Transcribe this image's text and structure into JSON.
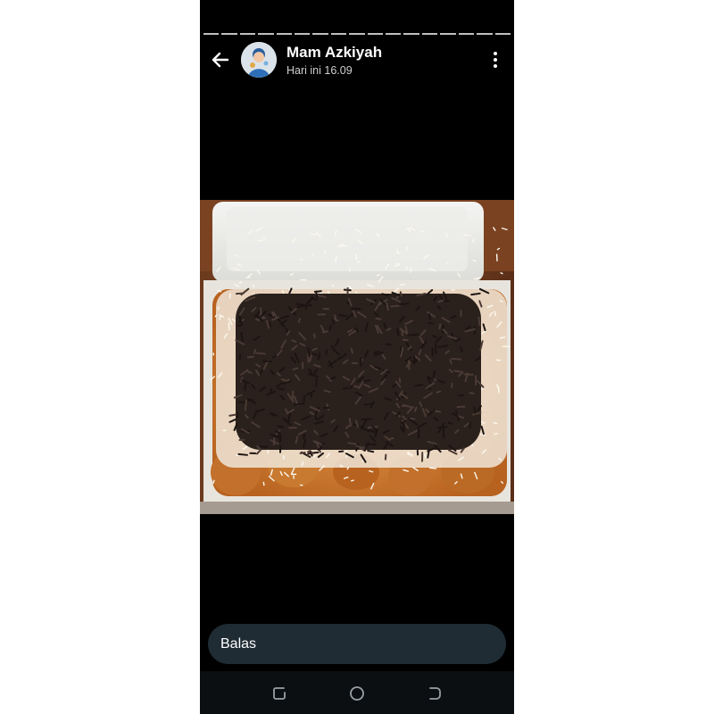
{
  "status": {
    "contact_name": "Mam Azkiyah",
    "timestamp": "Hari ini 16.09",
    "segments": 17
  },
  "header_icons": {
    "back": "arrow-left-icon",
    "menu": "vertical-dots-icon"
  },
  "photo": {
    "description_icon": "food-photo"
  },
  "reply": {
    "placeholder": "Balas"
  },
  "navigation": {
    "recent": "recent-apps-icon",
    "home": "home-circle-icon",
    "back": "back-icon"
  },
  "colors": {
    "background": "#000000",
    "reply_bg": "#1f2c34",
    "text": "#ffffff",
    "subtext": "#cfcfcf"
  }
}
